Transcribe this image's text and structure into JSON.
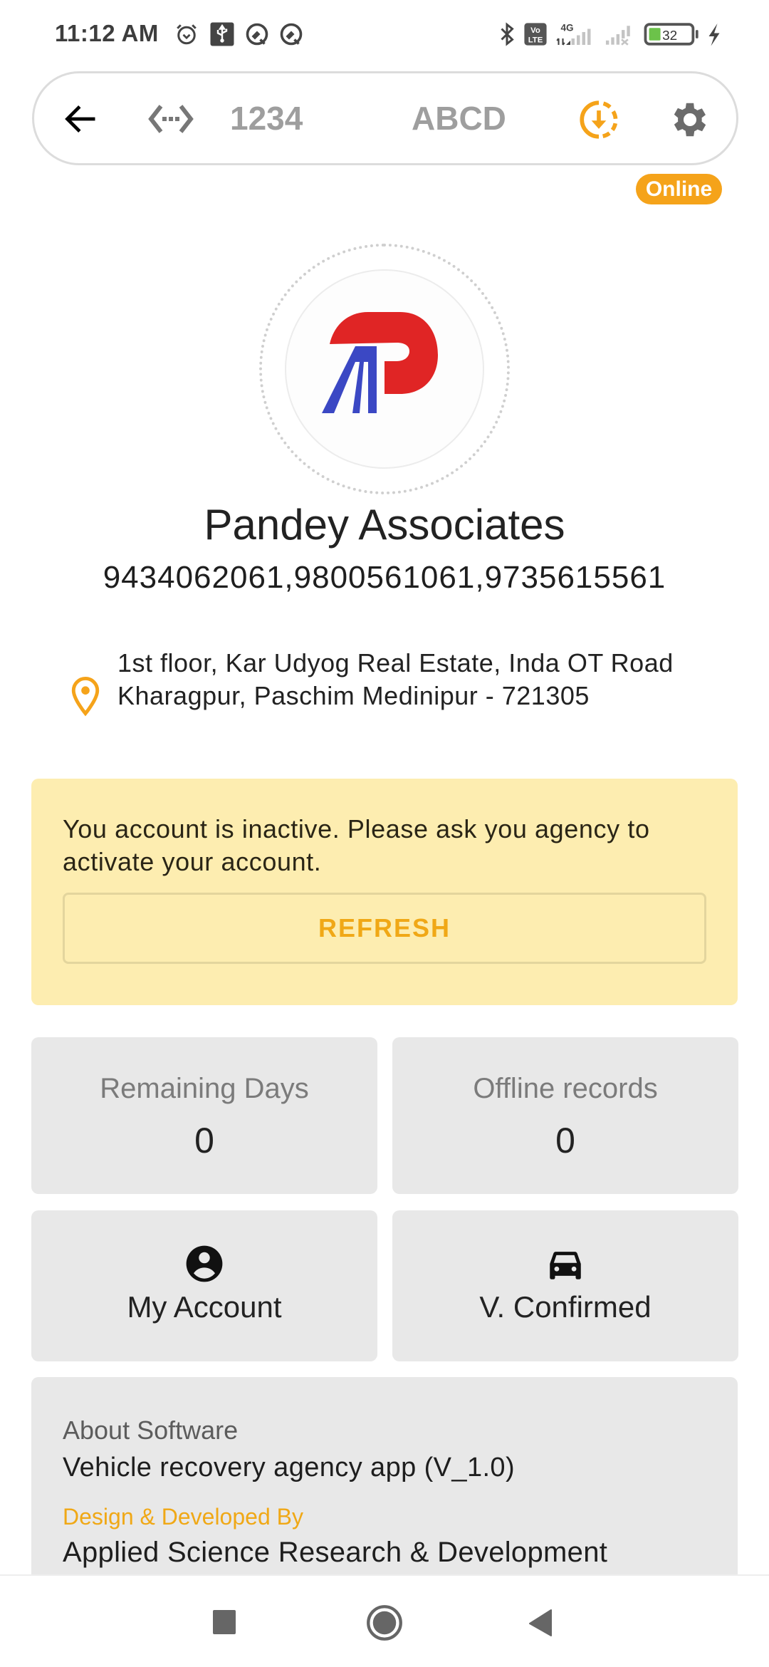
{
  "status_bar": {
    "time": "11:12 AM",
    "network": "4G",
    "volte": "Vo LTE",
    "battery_percent": "32",
    "charging": true,
    "icons": [
      "alarm-icon",
      "usb-icon",
      "dnd-icon",
      "dnd-icon",
      "bluetooth-icon",
      "volte-icon",
      "signal-icon",
      "signal-no-service-icon",
      "battery-icon",
      "charging-icon"
    ]
  },
  "app_bar": {
    "back_icon": "arrow-back-icon",
    "code_icon": "settings-ethernet-icon",
    "code_value": "1234",
    "name_value": "ABCD",
    "download_icon": "downloading-icon",
    "settings_icon": "gear-icon"
  },
  "status_badge": "Online",
  "profile": {
    "company_name": "Pandey Associates",
    "phones": "9434062061,9800561061,9735615561",
    "address": "1st floor, Kar Udyog Real Estate, Inda OT Road Kharagpur, Paschim Medinipur - 721305"
  },
  "alert": {
    "message": "You account is inactive. Please ask you agency to activate your account.",
    "refresh_label": "REFRESH"
  },
  "stats": [
    {
      "label": "Remaining Days",
      "value": "0"
    },
    {
      "label": "Offline records",
      "value": "0"
    }
  ],
  "actions": [
    {
      "label": "My Account",
      "icon": "account-circle-icon"
    },
    {
      "label": "V. Confirmed",
      "icon": "car-icon"
    }
  ],
  "about": {
    "heading": "About Software",
    "version": "Vehicle recovery agency app (V_1.0)",
    "developer_heading": "Design & Developed By",
    "developer": "Applied Science Research & Development"
  },
  "colors": {
    "accent": "#f5a31a",
    "alert_bg": "#fdedb0",
    "card_bg": "#e8e8e8",
    "logo_red": "#e02525",
    "logo_blue": "#3b48c4"
  }
}
